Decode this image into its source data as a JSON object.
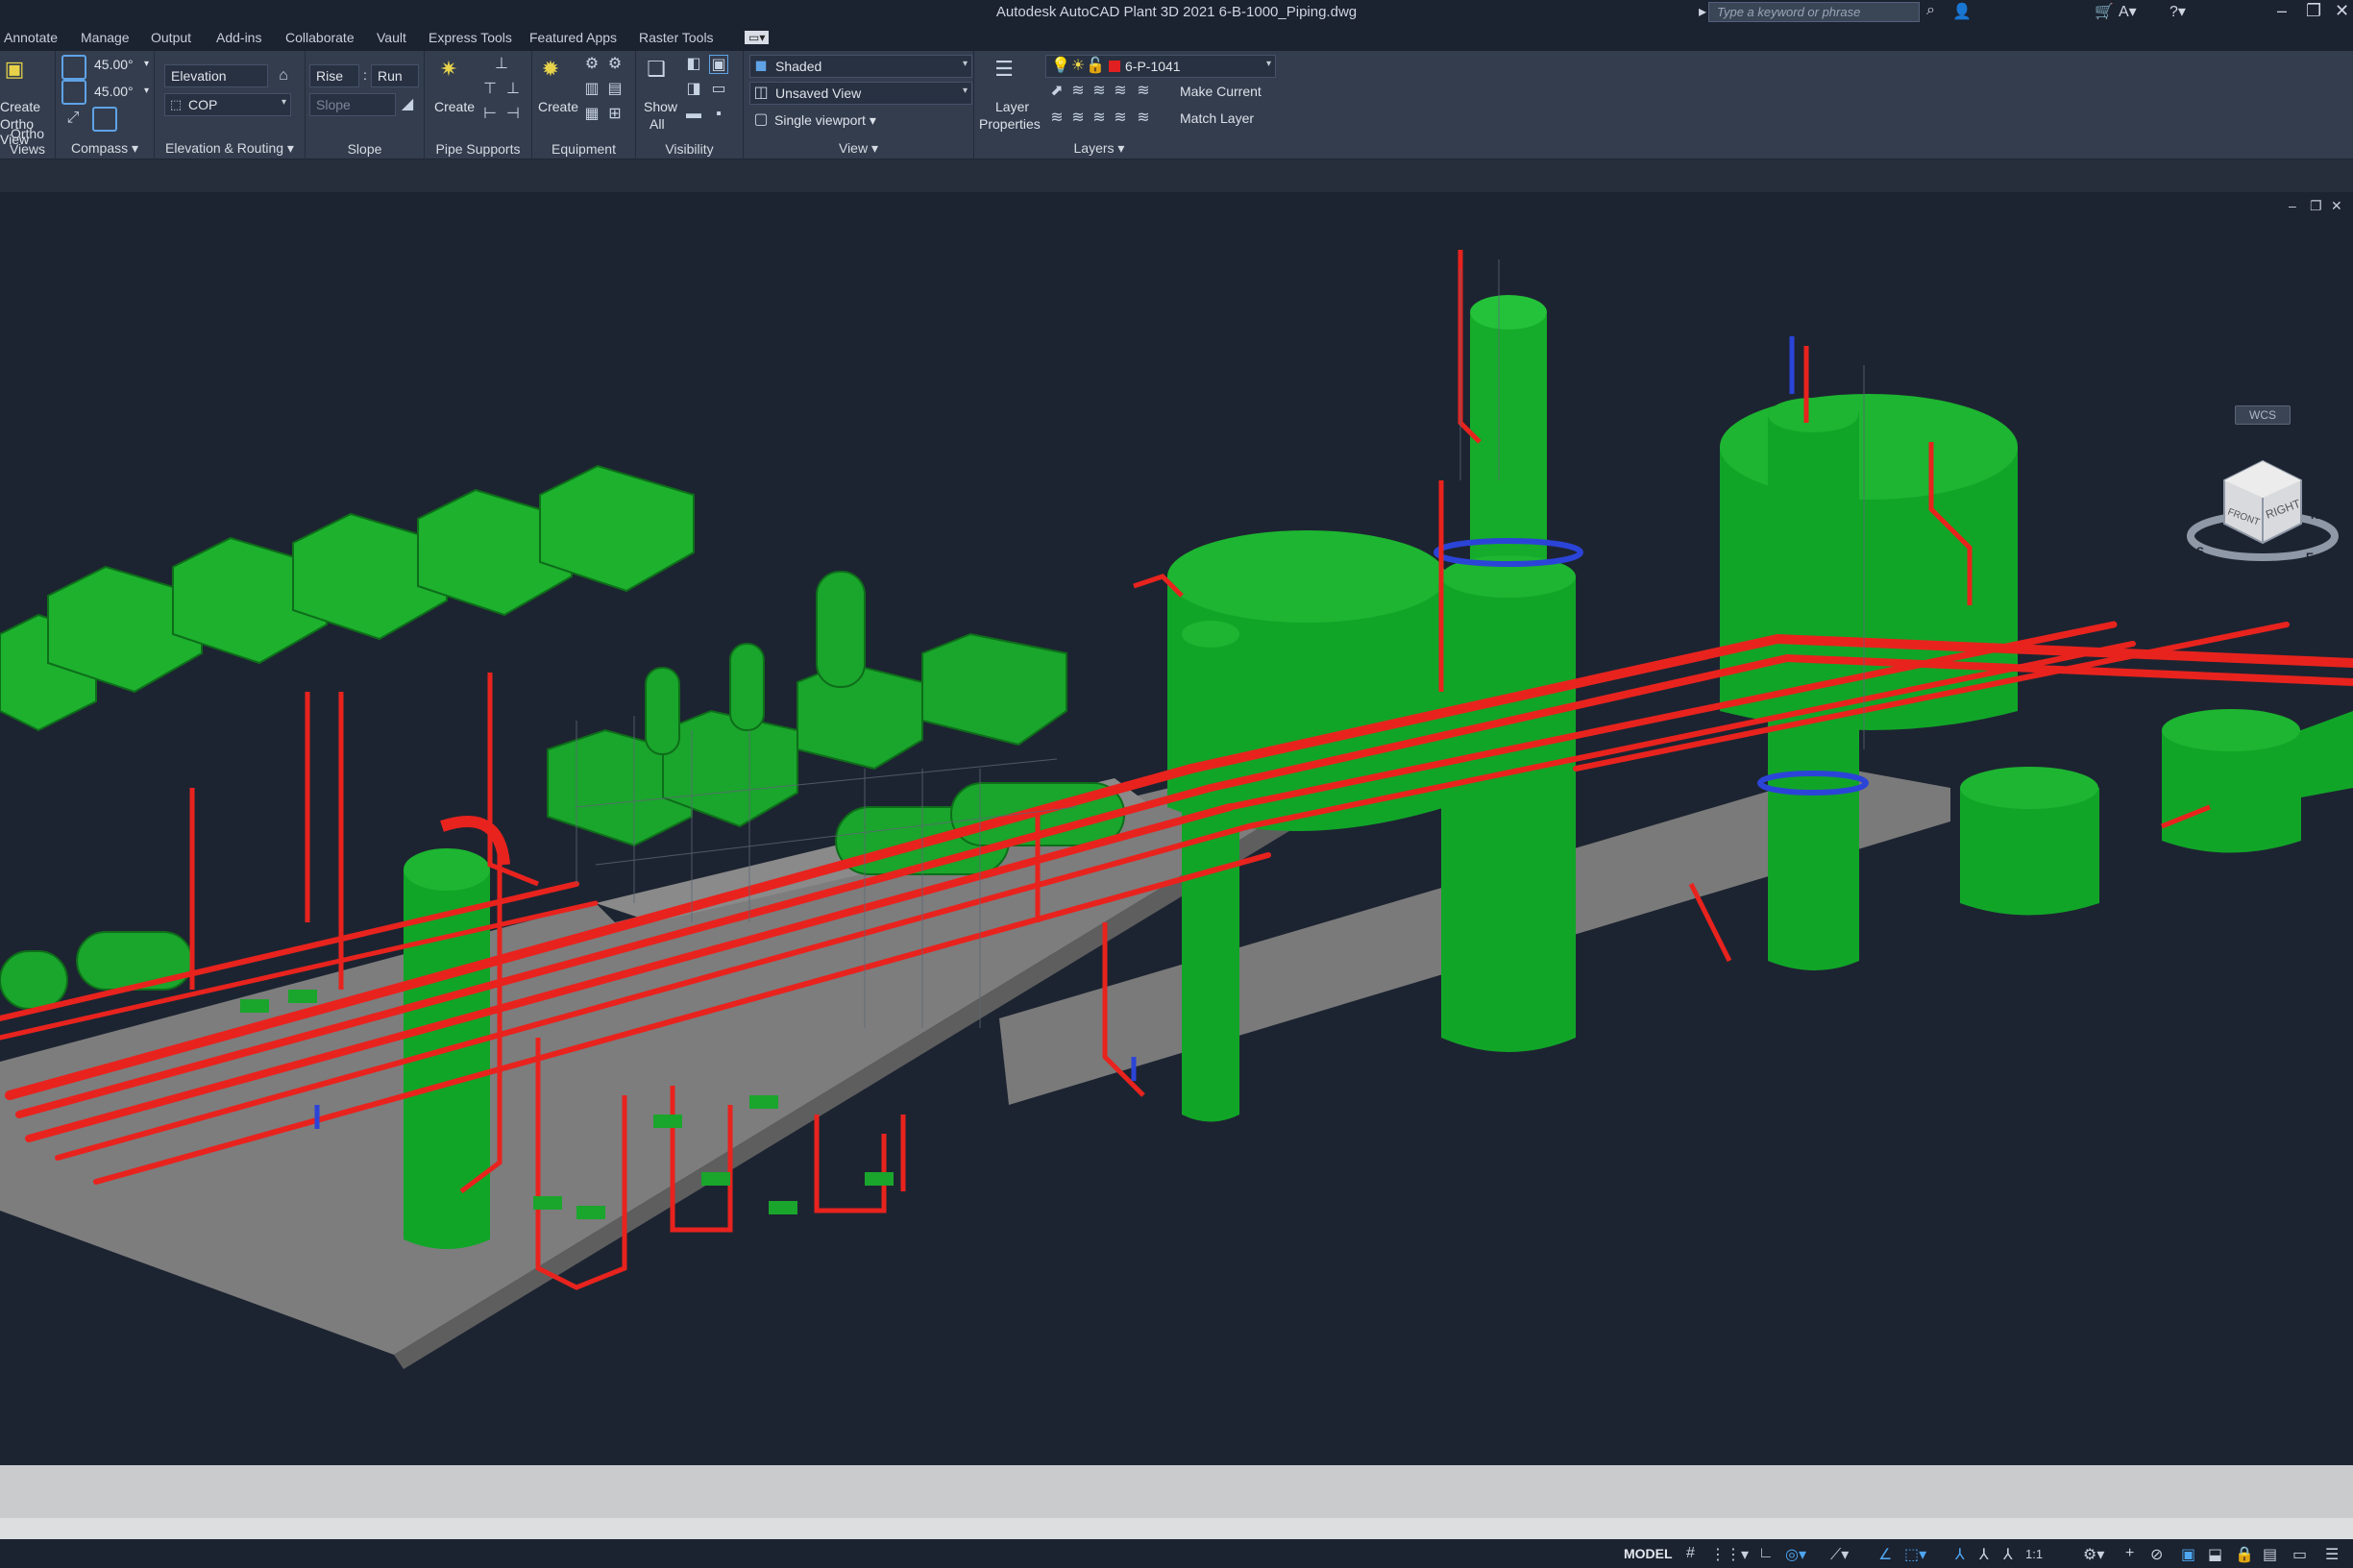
{
  "window": {
    "title": "Autodesk AutoCAD Plant 3D 2021    6-B-1000_Piping.dwg",
    "search_placeholder": "Type a keyword or phrase"
  },
  "tabs": [
    "Annotate",
    "Manage",
    "Output",
    "Add-ins",
    "Collaborate",
    "Vault",
    "Express Tools",
    "Featured Apps",
    "Raster Tools"
  ],
  "ribbon": {
    "ortho": {
      "create_label": "Create",
      "create_label2": "Ortho View",
      "panel": "Ortho Views"
    },
    "compass": {
      "angle1": "45.00°",
      "angle2": "45.00°",
      "panel": "Compass"
    },
    "elevation": {
      "elevation_field": "Elevation",
      "cop_field": "COP",
      "panel": "Elevation & Routing"
    },
    "slope": {
      "rise": "Rise",
      "run": "Run",
      "slope_field": "Slope",
      "panel": "Slope"
    },
    "pipe_supports": {
      "create_label": "Create",
      "panel": "Pipe Supports"
    },
    "equipment": {
      "create_label": "Create",
      "panel": "Equipment"
    },
    "visibility": {
      "show_all_1": "Show",
      "show_all_2": "All",
      "panel": "Visibility"
    },
    "view": {
      "visual_style": "Shaded",
      "named_view": "Unsaved View",
      "viewport_config": "Single viewport",
      "panel": "View"
    },
    "layers": {
      "layer_props_1": "Layer",
      "layer_props_2": "Properties",
      "current_layer": "6-P-1041",
      "make_current": "Make Current",
      "match_layer": "Match Layer",
      "panel": "Layers"
    }
  },
  "viewport": {
    "viewcube_front": "FRONT",
    "viewcube_right": "RIGHT",
    "compass_s": "S",
    "compass_e": "E",
    "compass_n": "N",
    "wcs_label": "WCS"
  },
  "status": {
    "model_label": "MODEL",
    "scale": "1:1"
  },
  "colors": {
    "equipment": "#1aa52c",
    "piping": "#e8231e",
    "background": "#1d2431",
    "slab": "#7d7d7d"
  }
}
